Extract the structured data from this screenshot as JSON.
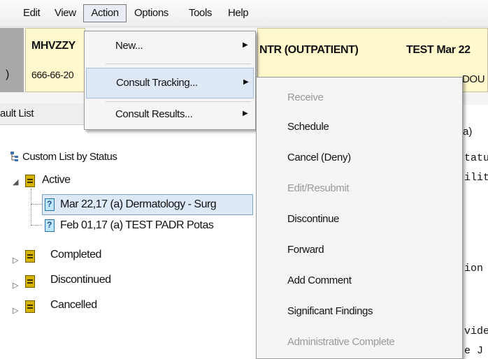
{
  "menubar": {
    "items": [
      "Edit",
      "View",
      "Action",
      "Options",
      "Tools",
      "Help"
    ]
  },
  "patient": {
    "name": "MHVZZY",
    "ssn": "666-66-20",
    "location": "NTR (OUTPATIENT)",
    "test_label": "TEST Mar 22",
    "test_sub": "DOU"
  },
  "list": {
    "header": "ault List",
    "root": "Custom List by Status",
    "active": "Active",
    "item1": "Mar 22,17  (a)  Dermatology - Surg",
    "item2": "Feb 01,17  (a)  TEST PADR Potas",
    "completed": "Completed",
    "discontinued": "Discontinued",
    "cancelled": "Cancelled"
  },
  "right_pane": {
    "header": "a)",
    "lines": [
      "tatu",
      "ilit",
      "ion",
      "vide",
      "e  J"
    ]
  },
  "action_menu": {
    "new": "New...",
    "consult_tracking": "Consult Tracking...",
    "consult_results": "Consult Results..."
  },
  "tracking_menu": {
    "receive": "Receive",
    "schedule": "Schedule",
    "cancel": "Cancel (Deny)",
    "edit": "Edit/Resubmit",
    "discontinue": "Discontinue",
    "forward": "Forward",
    "add_comment": "Add Comment",
    "significant": "Significant Findings",
    "admin_complete": "Administrative Complete"
  }
}
